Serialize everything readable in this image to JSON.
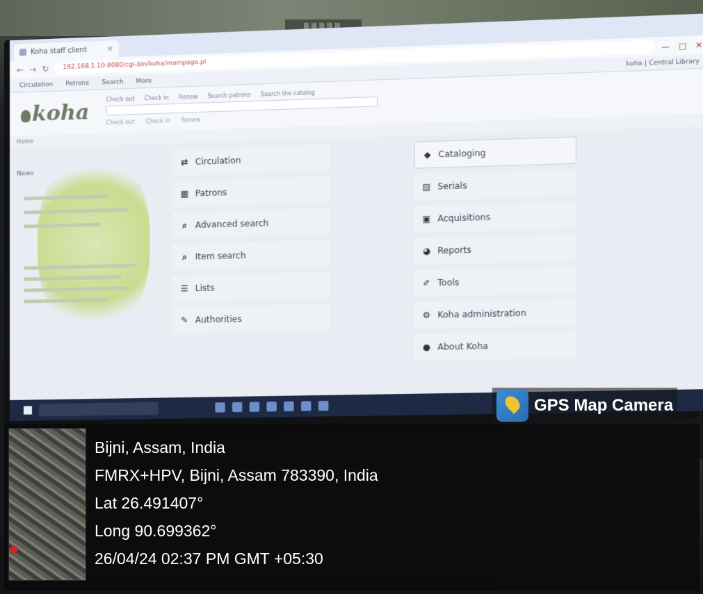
{
  "browser": {
    "tab_title": "Koha staff client",
    "url": "192.168.1.10:8080/cgi-bin/koha/mainpage.pl"
  },
  "koha": {
    "logo": "koha",
    "nav": [
      "Circulation",
      "Patrons",
      "Search",
      "More"
    ],
    "user": "koha | Central Library",
    "search_tabs": [
      "Check out",
      "Check in",
      "Renew",
      "Search patrons",
      "Search the catalog"
    ],
    "search_links": [
      "Check out",
      "Check in",
      "Renew"
    ],
    "breadcrumb": "Home",
    "side_title": "News",
    "modules_left": [
      {
        "icon": "circulation-icon",
        "label": "Circulation"
      },
      {
        "icon": "patrons-icon",
        "label": "Patrons"
      },
      {
        "icon": "search-icon",
        "label": "Advanced search"
      },
      {
        "icon": "search-icon",
        "label": "Item search"
      },
      {
        "icon": "lists-icon",
        "label": "Lists"
      },
      {
        "icon": "authorities-icon",
        "label": "Authorities"
      }
    ],
    "modules_right": [
      {
        "icon": "tag-icon",
        "label": "Cataloging"
      },
      {
        "icon": "serials-icon",
        "label": "Serials"
      },
      {
        "icon": "acquisitions-icon",
        "label": "Acquisitions"
      },
      {
        "icon": "reports-icon",
        "label": "Reports"
      },
      {
        "icon": "wrench-icon",
        "label": "Tools"
      },
      {
        "icon": "gear-icon",
        "label": "Koha administration"
      },
      {
        "icon": "about-icon",
        "label": "About Koha"
      }
    ]
  },
  "gps": {
    "brand": "GPS Map Camera",
    "place": "Bijni, Assam, India",
    "address": "FMRX+HPV, Bijni, Assam 783390, India",
    "lat": "Lat 26.491407°",
    "long": "Long 90.699362°",
    "datetime": "26/04/24 02:37 PM GMT +05:30"
  }
}
